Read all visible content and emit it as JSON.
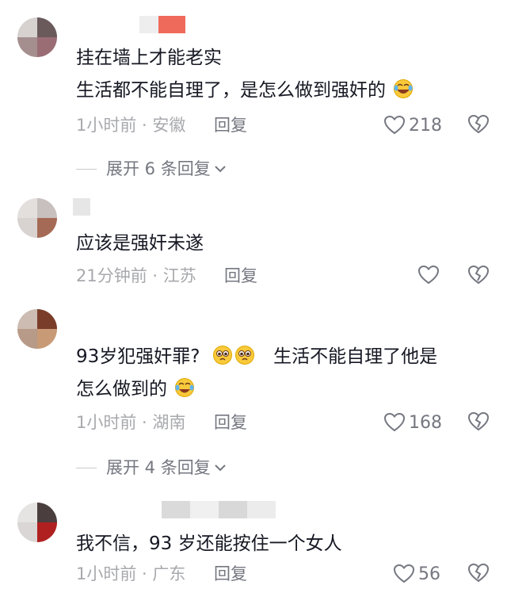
{
  "comments": [
    {
      "lines": [
        "挂在墙上才能老实",
        "生活都不能自理了，是怎么做到强奸的"
      ],
      "time_location": "1小时前 · 安徽",
      "reply_label": "回复",
      "likes": "218",
      "expand_label": "展开 6 条回复"
    },
    {
      "lines": [
        "应该是强奸未遂"
      ],
      "time_location": "21分钟前 · 江苏",
      "reply_label": "回复"
    },
    {
      "lines": [
        "93岁犯强奸罪?",
        "生活不能自理了他是",
        "怎么做到的"
      ],
      "time_location": "1小时前 · 湖南",
      "reply_label": "回复",
      "likes": "168",
      "expand_label": "展开 4 条回复"
    },
    {
      "lines": [
        "我不信，93 岁还能按住一个女人"
      ],
      "time_location": "1小时前 · 广东",
      "reply_label": "回复",
      "likes": "56"
    }
  ],
  "icons": {
    "like": "heart-outline-icon",
    "dislike": "broken-heart-icon",
    "expand": "chevron-down-icon",
    "emoji_laugh": "rofl-emoji",
    "emoji_plead": "pleading-face-emoji",
    "emoji_cry": "crying-laughing-emoji"
  },
  "colors": {
    "text": "#161823",
    "meta": "#a8a9ad",
    "action": "#757780"
  }
}
